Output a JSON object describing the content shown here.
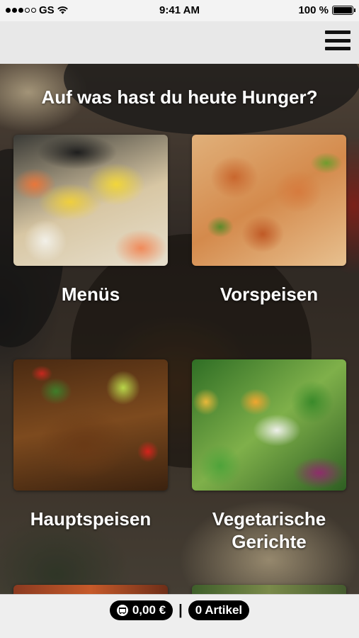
{
  "status_bar": {
    "carrier": "GS",
    "time": "9:41 AM",
    "battery": "100 %"
  },
  "nav": {
    "menu_icon": "hamburger-icon"
  },
  "main": {
    "heading": "Auf was hast du heute Hunger?",
    "categories": [
      {
        "label": "Menüs",
        "image": "sushi-platter"
      },
      {
        "label": "Vorspeisen",
        "image": "shrimp-glass-noodles"
      },
      {
        "label": "Hauptspeisen",
        "image": "fried-noodles-lime"
      },
      {
        "label": "Vegetarische Gerichte",
        "image": "stir-fried-vegetables"
      }
    ]
  },
  "cart": {
    "total": "0,00 €",
    "separator": "|",
    "items": "0 Artikel",
    "icon": "cart-icon"
  }
}
